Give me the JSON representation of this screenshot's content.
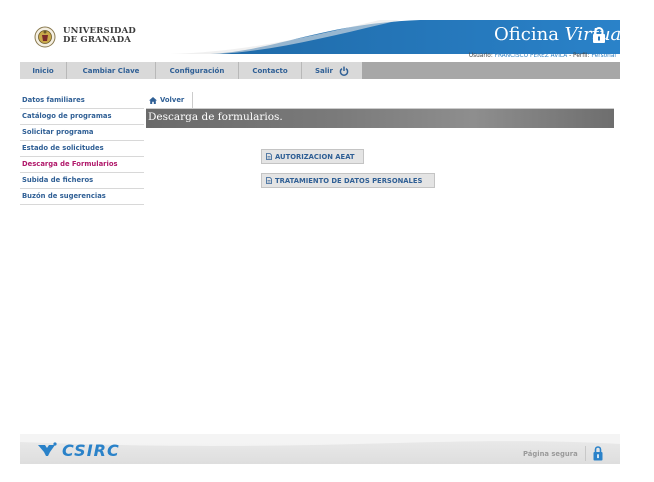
{
  "header": {
    "university_line1": "UNIVERSIDAD",
    "university_line2": "DE GRANADA",
    "title_main": "Oficina",
    "title_italic": "Virtual"
  },
  "userbar": {
    "user_label": "Usuario:",
    "user_name": "FRANCISCO PÉREZ ÁVILA",
    "separator": " - ",
    "profile_label": "Perfil:",
    "profile_value": "Personal"
  },
  "nav": {
    "items": [
      {
        "label": "Inicio"
      },
      {
        "label": "Cambiar Clave"
      },
      {
        "label": "Configuración"
      },
      {
        "label": "Contacto"
      },
      {
        "label": "Salir"
      }
    ]
  },
  "sidebar": {
    "items": [
      {
        "label": "Datos familiares",
        "active": false
      },
      {
        "label": "Catálogo de programas",
        "active": false
      },
      {
        "label": "Solicitar programa",
        "active": false
      },
      {
        "label": "Estado de solicitudes",
        "active": false
      },
      {
        "label": "Descarga de Formularios",
        "active": true
      },
      {
        "label": "Subida de ficheros",
        "active": false
      },
      {
        "label": "Buzón de sugerencias",
        "active": false
      }
    ]
  },
  "main": {
    "back_label": "Volver",
    "page_title": "Descarga de formularios.",
    "buttons": [
      {
        "label": "AUTORIZACION AEAT"
      },
      {
        "label": "TRATAMIENTO DE DATOS PERSONALES"
      }
    ]
  },
  "footer": {
    "logo_text": "CSIRC",
    "secure_label": "Página segura"
  },
  "colors": {
    "header_blue": "#2676b8",
    "link_blue": "#2f5f95",
    "active_magenta": "#b0186a",
    "nav_bg": "#d9d9d9",
    "title_bar_gray": "#7a7a7a",
    "footer_blue": "#2a82c9"
  },
  "icons": {
    "lock": "lock-icon",
    "power": "power-icon",
    "home": "home-icon",
    "document": "document-icon",
    "csirc": "csirc-logo",
    "secure_lock": "secure-lock-icon"
  }
}
